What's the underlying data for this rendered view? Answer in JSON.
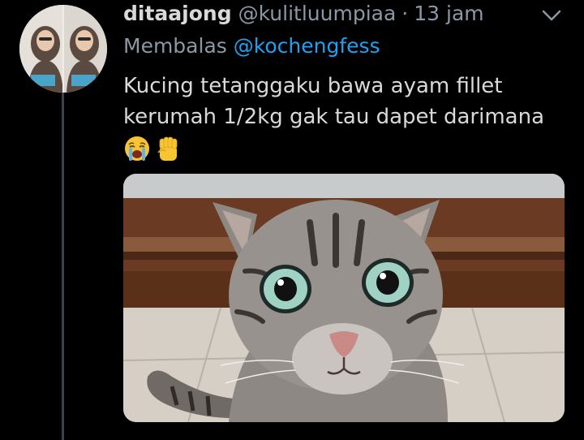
{
  "tweet": {
    "display_name": "ditaajong",
    "handle": "@kulitluumpiaa",
    "separator": "·",
    "time": "13 jam",
    "reply_prefix": "Membalas",
    "reply_to": "@kochengfess",
    "text_line1": "Kucing tetanggaku bawa ayam fillet",
    "text_line2": "kerumah 1/2kg gak tau dapet darimana",
    "emojis": [
      "crying-face",
      "raised-fist"
    ]
  },
  "colors": {
    "background": "#000000",
    "text_primary": "#d9d9d9",
    "text_secondary": "#8b98a5",
    "link": "#1da1f2",
    "thread_line": "#38444d"
  },
  "icons": {
    "more": "chevron-down-icon"
  }
}
